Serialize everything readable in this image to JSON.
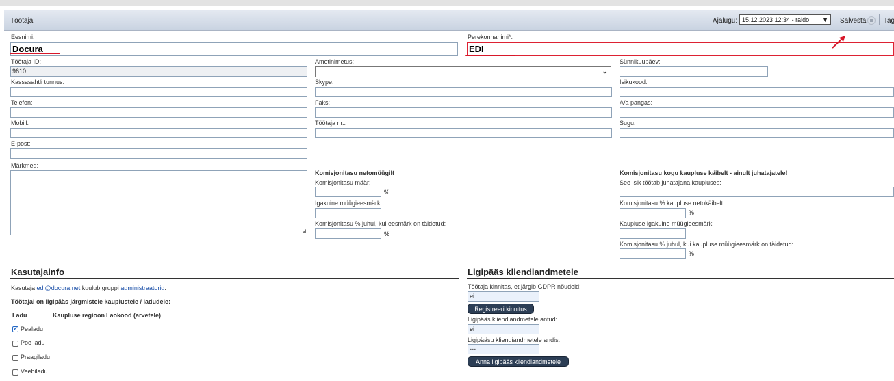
{
  "window": {
    "title": "Töötaja"
  },
  "history": {
    "label": "Ajalugu:",
    "selected": "15.12.2023 12:34 - raido"
  },
  "toolbar": {
    "save_label": "Salvesta",
    "back_label": "Taga"
  },
  "fields": {
    "eesnimi": {
      "label": "Eesnimi:",
      "value": "Docura"
    },
    "perekonnanimi": {
      "label": "Perekonnanimi*:",
      "value": "EDI"
    },
    "tootaja_id": {
      "label": "Töötaja ID:",
      "value": "9610"
    },
    "ametinimetus": {
      "label": "Ametinimetus:"
    },
    "synnikuupaev": {
      "label": "Sünnikuupäev:"
    },
    "kassasahtli": {
      "label": "Kassasahtli tunnus:"
    },
    "skype": {
      "label": "Skype:"
    },
    "isikukood": {
      "label": "Isikukood:"
    },
    "telefon": {
      "label": "Telefon:"
    },
    "faks": {
      "label": "Faks:"
    },
    "aa_pangas": {
      "label": "A/a pangas:"
    },
    "mobiil": {
      "label": "Mobiil:"
    },
    "tootaja_nr": {
      "label": "Töötaja nr.:"
    },
    "sugu": {
      "label": "Sugu:"
    },
    "epost": {
      "label": "E-post:"
    },
    "markmed": {
      "label": "Märkmed:"
    }
  },
  "commission_net": {
    "title": "Komisjonitasu netomüügilt",
    "rate_label": "Komisjonitasu määr:",
    "target_label": "Igakuine müügieesmärk:",
    "achieved_label": "Komisjonitasu % juhul, kui eesmärk on täidetud:",
    "pct": "%"
  },
  "commission_store": {
    "title": "Komisjonitasu kogu kaupluse käibelt - ainult juhatajatele!",
    "store_label": "See isik töötab juhatajana kaupluses:",
    "rate_label": "Komisjonitasu % kaupluse netokäibelt:",
    "target_label": "Kaupluse igakuine müügieesmärk:",
    "achieved_label": "Komisjonitasu % juhul, kui kaupluse müügieesmärk on täidetud:",
    "pct": "%"
  },
  "userinfo": {
    "heading": "Kasutajainfo",
    "text_pre": "Kasutaja",
    "user_link": "edi@docura.net",
    "text_mid": "kuulub gruppi",
    "group_link": "administraatorid",
    "text_post": ".",
    "access_title": "Töötajal on ligipääs järgmistele kauplustele / ladudele:",
    "columns": [
      "Ladu",
      "Kaupluse regioon",
      "Laokood (arvetele)"
    ],
    "warehouses": [
      {
        "name": "Pealadu",
        "checked": true
      },
      {
        "name": "Poe ladu",
        "checked": false
      },
      {
        "name": "Praagiladu",
        "checked": false
      },
      {
        "name": "Veebiladu",
        "checked": false
      }
    ]
  },
  "client_access": {
    "heading": "Ligipääs kliendiandmetele",
    "gdpr_label": "Töötaja kinnitas, et järgib GDPR nõudeid:",
    "gdpr_value": "ei",
    "register_button": "Registreeri kinnitus",
    "granted_label": "Ligipääs kliendiandmetele antud:",
    "granted_value": "ei",
    "granter_label": "Ligipääsu kliendiandmetele andis:",
    "granter_value": "---",
    "grant_button": "Anna ligipääs kliendiandmetele"
  },
  "colors": {
    "annotation_red": "#d8182a",
    "button_dark": "#2c3e55",
    "title_bar": "#c9d3e1"
  }
}
